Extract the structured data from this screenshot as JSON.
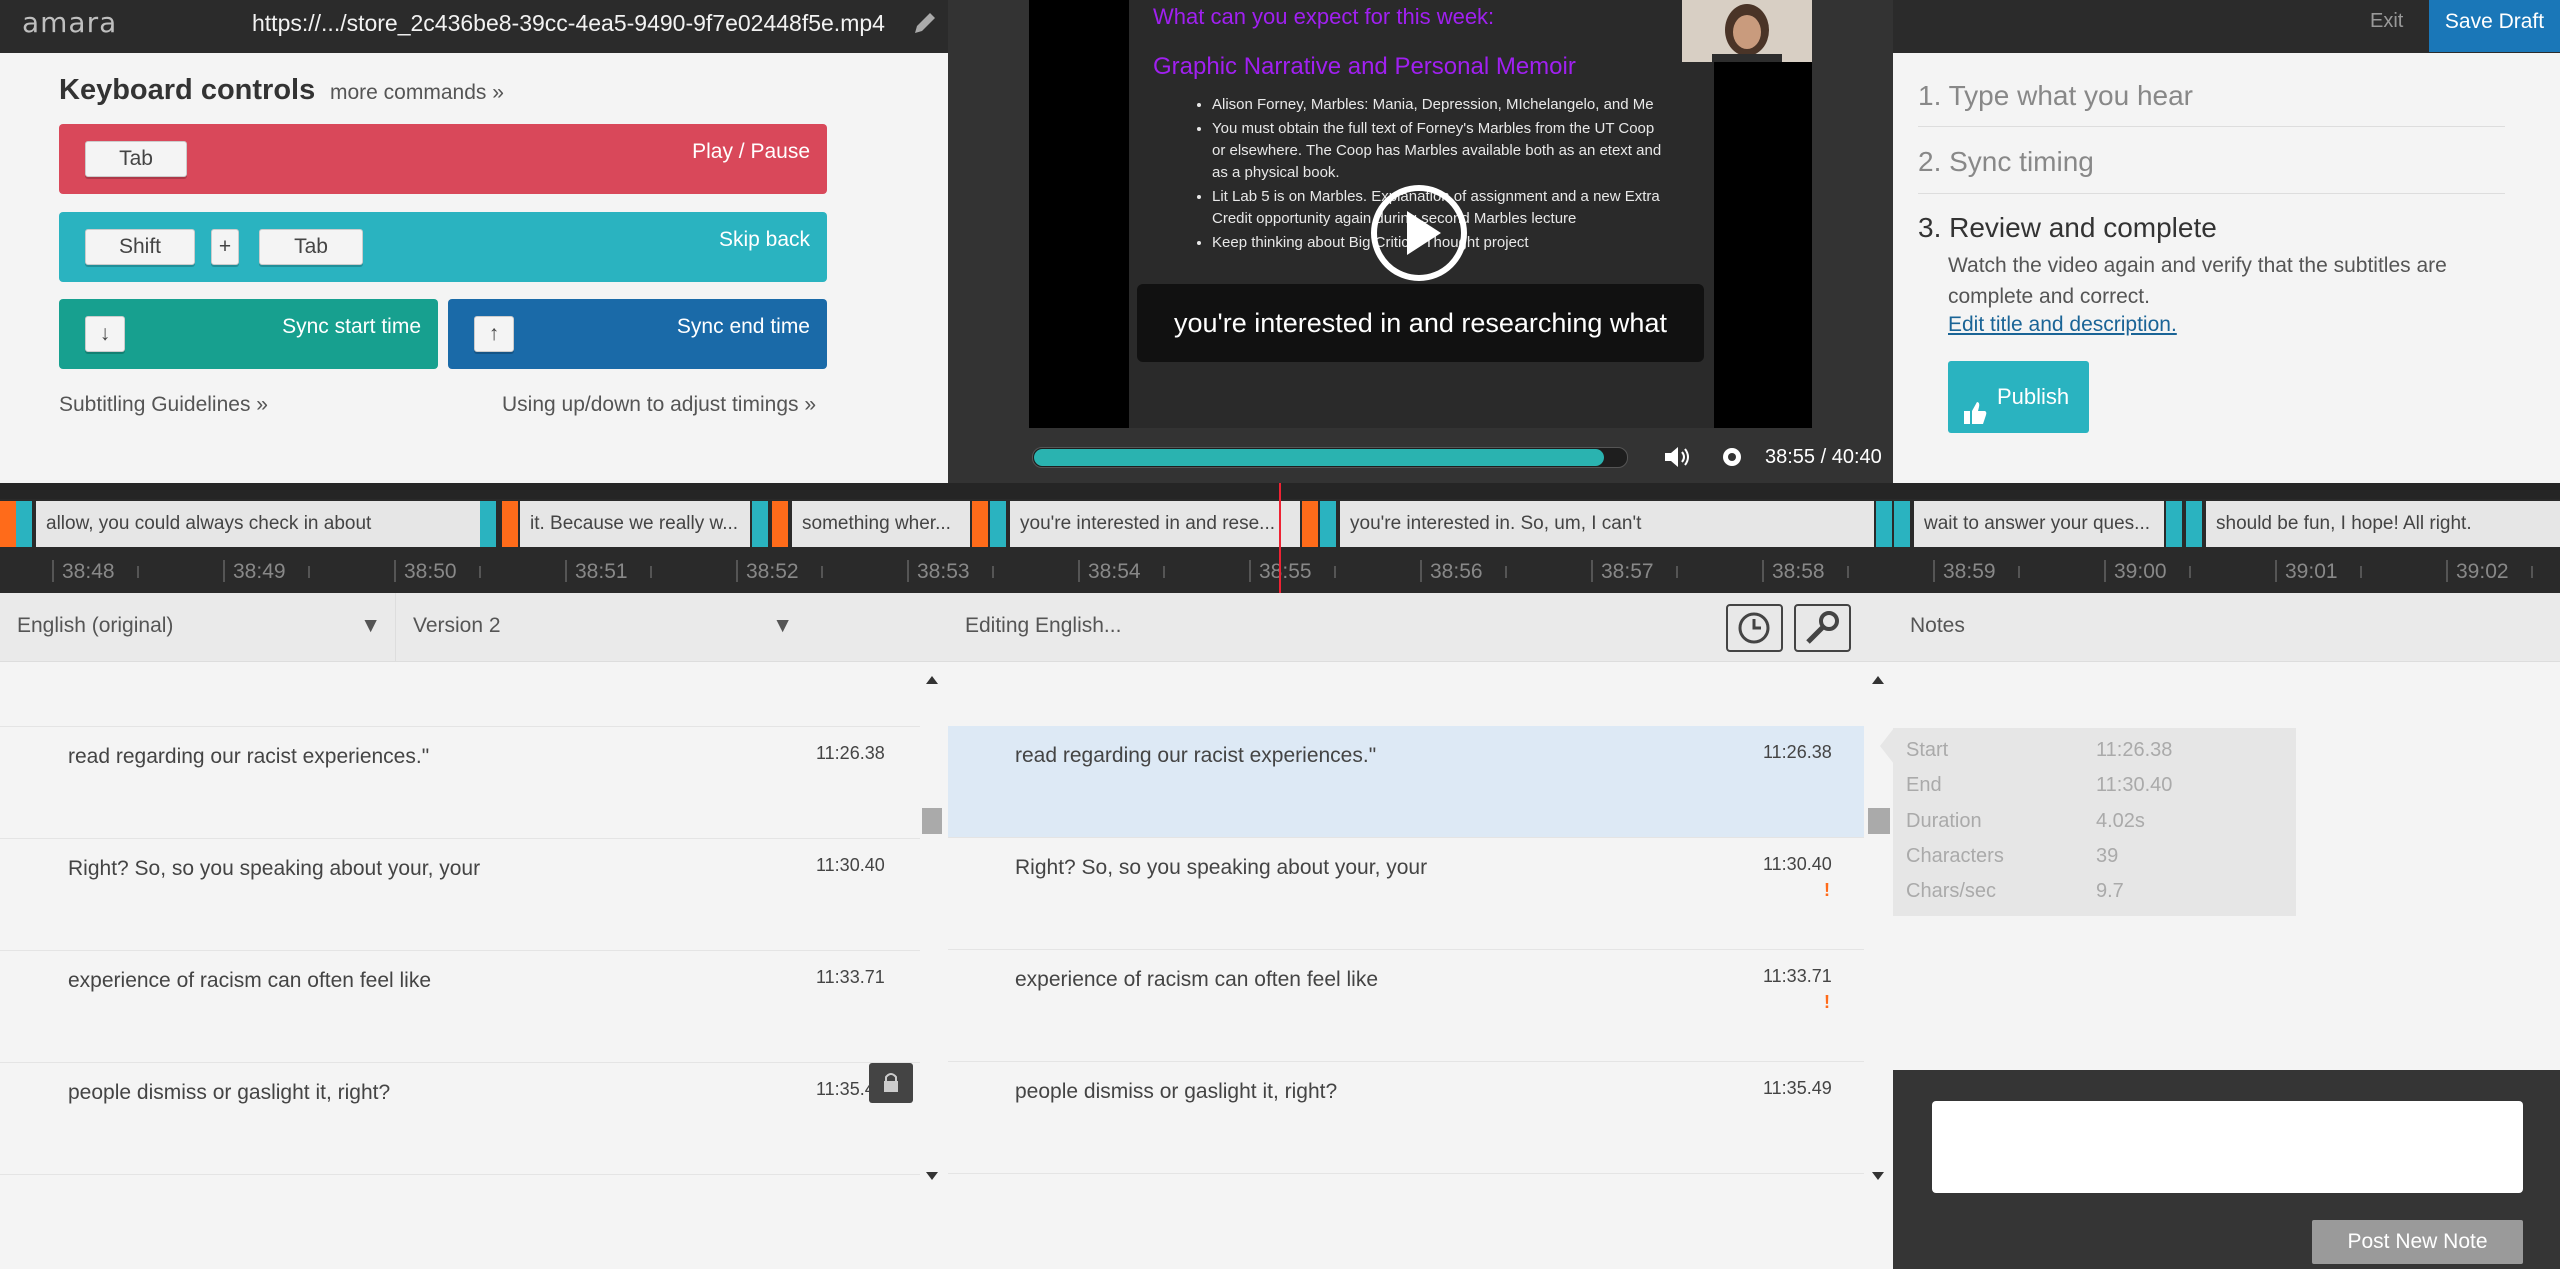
{
  "header": {
    "logo": "amara",
    "url": "https://.../store_2c436be8-39cc-4ea5-9490-9f7e02448f5e.mp4",
    "exit": "Exit",
    "save_draft": "Save Draft"
  },
  "keyboard": {
    "title": "Keyboard controls",
    "more": "more commands »",
    "play_pause": {
      "keys": [
        "Tab"
      ],
      "label": "Play / Pause"
    },
    "skip_back": {
      "keys": [
        "Shift",
        "+",
        "Tab"
      ],
      "label": "Skip back"
    },
    "sync_start": {
      "key": "↓",
      "label": "Sync start time"
    },
    "sync_end": {
      "key": "↑",
      "label": "Sync end time"
    },
    "guidelines": "Subtitling Guidelines »",
    "updown": "Using up/down to adjust timings »"
  },
  "video": {
    "slide_title": "What can you expect for this week:",
    "slide_subtitle": "Graphic Narrative and Personal Memoir",
    "bullets": [
      "Alison Forney, Marbles: Mania, Depression, MIchelangelo, and Me",
      "You must obtain the full text of Forney's Marbles from the UT Coop or elsewhere. The Coop has Marbles available both as an etext and as a physical book.",
      "Lit Lab 5 is on Marbles. Explanation of assignment and a new Extra Credit opportunity again during second Marbles lecture",
      "Keep thinking about Big Critical Thought project"
    ],
    "caption": "you're interested in and researching what",
    "time": "38:55 / 40:40",
    "progress": 0.957
  },
  "steps": {
    "step1": "1. Type what you hear",
    "step2": "2. Sync timing",
    "step3": "3. Review and complete",
    "step3_desc": "Watch the video again and verify that the subtitles are complete and correct.",
    "edit_link": "Edit title and description.",
    "publish": "Publish"
  },
  "timeline": {
    "segments": [
      "allow, you could always check in about",
      "it. Because we really w...",
      "something wher...",
      "you're interested in and rese...",
      "you're interested in. So, um, I can't",
      "wait to answer your ques...",
      "should be fun, I hope! All right."
    ],
    "ticks": [
      "38:48",
      "38:49",
      "38:50",
      "38:51",
      "38:52",
      "38:53",
      "38:54",
      "38:55",
      "38:56",
      "38:57",
      "38:58",
      "38:59",
      "39:00",
      "39:01",
      "39:02"
    ]
  },
  "left_list": {
    "lang": "English (original)",
    "version": "Version 2",
    "rows": [
      {
        "text": "read regarding our racist experiences.\"",
        "time": "11:26.38"
      },
      {
        "text": "Right? So, so you speaking about your, your",
        "time": "11:30.40"
      },
      {
        "text": "experience of racism can often feel like",
        "time": "11:33.71"
      },
      {
        "text": "people dismiss or gaslight it, right?",
        "time": "11:35.4"
      }
    ]
  },
  "editor": {
    "title": "Editing English...",
    "rows": [
      {
        "text": "read regarding our racist experiences.\"",
        "time": "11:26.38",
        "warn": ""
      },
      {
        "text": "Right? So, so you speaking about your, your",
        "time": "11:30.40",
        "warn": "!"
      },
      {
        "text": "experience of racism can often feel like",
        "time": "11:33.71",
        "warn": "!"
      },
      {
        "text": "people dismiss or gaslight it, right?",
        "time": "11:35.49",
        "warn": ""
      }
    ]
  },
  "notes": {
    "title": "Notes",
    "info": [
      {
        "label": "Start",
        "value": "11:26.38"
      },
      {
        "label": "End",
        "value": "11:30.40"
      },
      {
        "label": "Duration",
        "value": "4.02s"
      },
      {
        "label": "Characters",
        "value": "39"
      },
      {
        "label": "Chars/sec",
        "value": "9.7"
      }
    ],
    "post": "Post New Note"
  },
  "colors": {
    "red": "#d9485a",
    "teal": "#2ab3c0",
    "green": "#17a08f",
    "blue": "#1a6aa8",
    "orange": "#ff6b1a"
  }
}
